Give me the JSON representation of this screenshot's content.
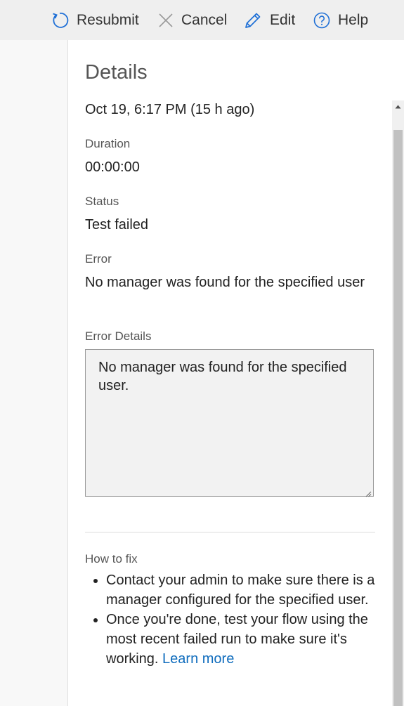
{
  "toolbar": {
    "resubmit": {
      "label": "Resubmit",
      "icon": "refresh-icon"
    },
    "cancel": {
      "label": "Cancel",
      "icon": "close-icon"
    },
    "edit": {
      "label": "Edit",
      "icon": "pencil-icon"
    },
    "help": {
      "label": "Help",
      "icon": "help-icon"
    }
  },
  "details": {
    "title": "Details",
    "timestamp": "Oct 19, 6:17 PM (15 h ago)",
    "duration_label": "Duration",
    "duration_value": "00:00:00",
    "status_label": "Status",
    "status_value": "Test failed",
    "error_label": "Error",
    "error_value": "No manager was found for the specified user",
    "error_details_label": "Error Details",
    "error_details_value": "No manager was found for the specified user.",
    "how_to_fix_label": "How to fix",
    "fix_items": [
      "Contact your admin to make sure there is a manager configured for the specified user.",
      "Once you're done, test your flow using the most recent failed run to make sure it's working."
    ],
    "learn_more": "Learn more"
  },
  "colors": {
    "toolbar_bg": "#efefef",
    "accent": "#0f6cbd",
    "icon_blue": "#1e6fd6"
  }
}
